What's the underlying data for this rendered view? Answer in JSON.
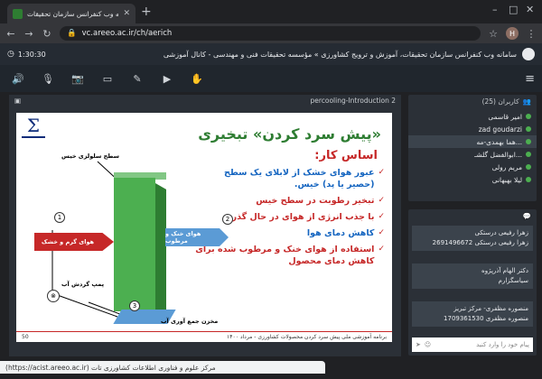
{
  "browser": {
    "tab_title": "سامانه وب کنفرانس سازمان تحقیقات...",
    "url": "vc.areeo.ac.ir/ch/aerich",
    "profile_initial": "H"
  },
  "app": {
    "timer": "1:30:30",
    "meeting_title": "سامانه وب کنفرانس سازمان تحقیقات، آموزش و ترویج کشاورزی » مؤسسه تحقیقات فنی و مهندسی - کانال آموزشی"
  },
  "presentation": {
    "name": "percooling-Introduction 2",
    "slide": {
      "logo_mark": "Σ",
      "title": "«پیش سرد کردن» تبخیری",
      "heading": "اساس کار:",
      "bullets": [
        "عبور هوای خشک از لابلای یک سطح (حصیر یا پد) خیس.",
        "تبخیر رطوبت در سطح خیس",
        "با جذب انرژی از هوای در حال گذر",
        "کاهش دمای هوا",
        "استفاده از هوای خنک و مرطوب شده برای کاهش دمای محصول"
      ],
      "diagram": {
        "pad_label": "سطح سلولزی خیس",
        "hot_air": "هوای گرم و خشک",
        "cool_air": "هوای خنک و مرطوب",
        "pump": "پمپ گردش آب",
        "tank": "مخزن جمع آوری آب",
        "nums": [
          "1",
          "2",
          "3"
        ]
      },
      "footer_text": "برنامه آموزشی ملی پیش سرد کردن محصولات کشاورزی - مرداد ۱۴۰۰",
      "page_num": "50"
    }
  },
  "users": {
    "header": "کاربران (25)",
    "list": [
      {
        "name": "امیر قاسمی",
        "active": false
      },
      {
        "name": "zad goudarzi",
        "active": false
      },
      {
        "name": "هما بهمدی-مه...",
        "active": true
      },
      {
        "name": "ابوالفضل گلشـ...",
        "active": false
      },
      {
        "name": "مریم رولی",
        "active": false
      },
      {
        "name": "لیلا بهبهانی",
        "active": false
      }
    ]
  },
  "chat": {
    "messages": [
      {
        "line1": "زهرا رفیعی درستکی",
        "line2": "زهرا رفیعی درستکی 2691496672"
      },
      {
        "line1": "دکتر الهام آذرپژوه",
        "line2": "سیاسگزارم"
      },
      {
        "line1": "منصوره مظفری- مرکز تبریز",
        "line2": "منصوره مظفری 1709361530"
      }
    ],
    "placeholder": "پیام خود را وارد کنید"
  },
  "status_bar": "مرکز علوم و فناوری اطلاعات کشاورزی تات (https://acist.areeo.ac.ir)"
}
